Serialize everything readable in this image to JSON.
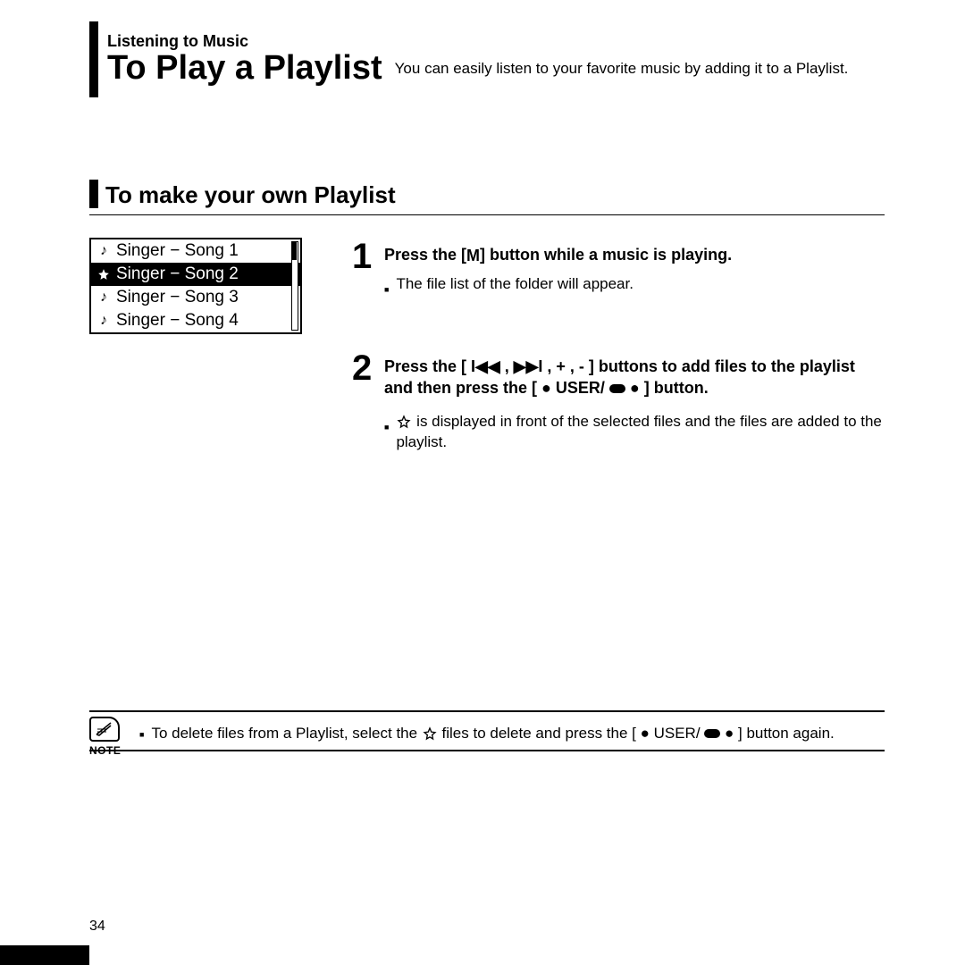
{
  "chapter": "Listening to Music",
  "title": "To Play a Playlist",
  "subtitle": "You can easily listen to your favorite music by adding it to a Playlist.",
  "subheading": "To make your own Playlist",
  "screen": {
    "items": [
      {
        "icon": "note",
        "label": "Singer − Song 1",
        "selected": false
      },
      {
        "icon": "star",
        "label": "Singer − Song 2",
        "selected": true
      },
      {
        "icon": "note",
        "label": "Singer − Song 3",
        "selected": false
      },
      {
        "icon": "note",
        "label": "Singer − Song 4",
        "selected": false
      }
    ]
  },
  "steps": [
    {
      "num": "1",
      "head_pre": "Press the [",
      "head_mid": "M",
      "head_post": "] button while a music is playing.",
      "bullets": [
        "The file list of the folder will appear."
      ]
    },
    {
      "num": "2",
      "head_full": "Press the [ I◀◀ , ▶▶I , + , - ] buttons to add files to the playlist and then press the [ ● USER/ ⬬ ● ] button.",
      "bullets_rich": [
        {
          "pre": "",
          "star": true,
          "post": " is displayed in front of the selected files and the files are added to the playlist."
        }
      ]
    }
  ],
  "note": {
    "label": "NOTE",
    "text_pre": "To delete files from a Playlist, select the ",
    "text_mid": "",
    "text_post": " files to delete and press the [ ● USER/ ⬬ ● ] button again."
  },
  "page_number": "34"
}
